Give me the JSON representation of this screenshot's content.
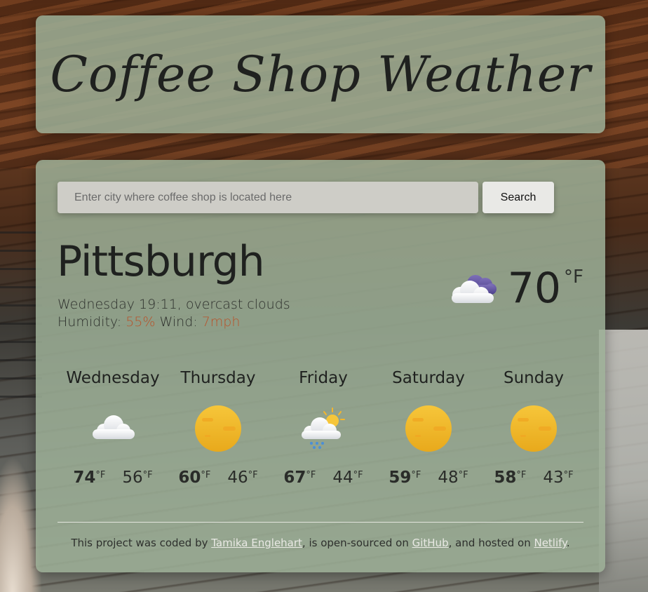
{
  "header": {
    "title": "Coffee Shop Weather"
  },
  "search": {
    "placeholder": "Enter city where coffee shop is located here",
    "button_label": "Search"
  },
  "current": {
    "city": "Pittsburgh",
    "datetime_description": "Wednesday 19:11, overcast clouds",
    "humidity_label": "Humidity:",
    "humidity_value": "55%",
    "wind_label": "Wind:",
    "wind_value": "7mph",
    "temperature": "70",
    "unit": "°F",
    "icon": "overcast-clouds-icon"
  },
  "forecast": [
    {
      "day": "Wednesday",
      "icon": "cloud-icon",
      "high": "74",
      "low": "56",
      "unit": "°F"
    },
    {
      "day": "Thursday",
      "icon": "sun-icon",
      "high": "60",
      "low": "46",
      "unit": "°F"
    },
    {
      "day": "Friday",
      "icon": "rain-sun-icon",
      "high": "67",
      "low": "44",
      "unit": "°F"
    },
    {
      "day": "Saturday",
      "icon": "sun-icon",
      "high": "59",
      "low": "48",
      "unit": "°F"
    },
    {
      "day": "Sunday",
      "icon": "sun-icon",
      "high": "58",
      "low": "43",
      "unit": "°F"
    }
  ],
  "footer": {
    "text_1": "This project was coded by ",
    "author_link": "Tamika Englehart",
    "text_2": ", is open-sourced on ",
    "github_link": "GitHub",
    "text_3": ", and hosted on ",
    "netlify_link": "Netlify",
    "text_4": "."
  },
  "colors": {
    "card_background": "#9caf96",
    "highlight": "#b8532a",
    "sun": "#f2b92a"
  }
}
